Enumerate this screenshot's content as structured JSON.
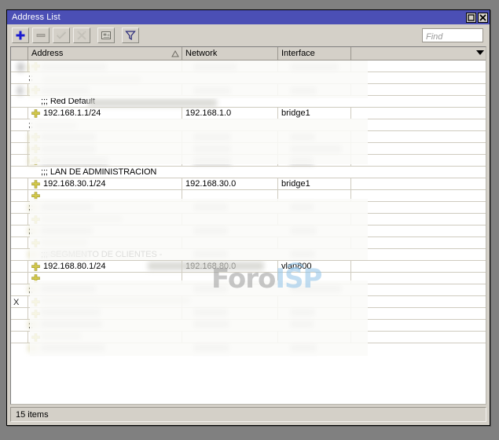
{
  "window": {
    "title": "Address List",
    "buttons": [
      {
        "name": "maximize",
        "glyph": "maximize-icon"
      },
      {
        "name": "close",
        "glyph": "close-icon"
      }
    ]
  },
  "toolbar": {
    "buttons": [
      {
        "name": "add-button",
        "icon": "plus-icon",
        "enabled": true,
        "label": "Add"
      },
      {
        "name": "remove-button",
        "icon": "minus-icon",
        "enabled": false,
        "label": "Remove"
      },
      {
        "name": "enable-button",
        "icon": "check-icon",
        "enabled": false,
        "label": "Enable"
      },
      {
        "name": "disable-button",
        "icon": "cross-icon",
        "enabled": false,
        "label": "Disable"
      },
      {
        "name": "comment-button",
        "icon": "comment-icon",
        "enabled": true,
        "label": "Comment"
      },
      {
        "name": "filter-button",
        "icon": "funnel-icon",
        "enabled": true,
        "label": "Filter"
      }
    ],
    "find_placeholder": "Find",
    "find_value": ""
  },
  "table": {
    "columns": [
      {
        "key": "flag",
        "label": ""
      },
      {
        "key": "address",
        "label": "Address",
        "sorted": "asc"
      },
      {
        "key": "network",
        "label": "Network"
      },
      {
        "key": "interface",
        "label": "Interface"
      },
      {
        "key": "extra",
        "label": ""
      }
    ],
    "rows": [
      {
        "type": "address",
        "flag": "",
        "address": "",
        "network": "",
        "interface": "",
        "redacted": true
      },
      {
        "type": "comment",
        "comment": "",
        "redacted": true
      },
      {
        "type": "address",
        "flag": "",
        "address": "",
        "network": "",
        "interface": "",
        "redacted": true
      },
      {
        "type": "comment",
        "comment": ";;; Red Default",
        "redacted_tail": true
      },
      {
        "type": "address",
        "flag": "",
        "address": "192.168.1.1/24",
        "network": "192.168.1.0",
        "interface": "bridge1"
      },
      {
        "type": "comment",
        "comment": "",
        "redacted": true
      },
      {
        "type": "address",
        "flag": "",
        "address": "",
        "network": "",
        "interface": "",
        "redacted": true
      },
      {
        "type": "address",
        "flag": "",
        "address": "",
        "network": "",
        "interface": "",
        "redacted": true
      },
      {
        "type": "address",
        "flag": "",
        "address": "",
        "network": "",
        "interface": "",
        "redacted": true
      },
      {
        "type": "comment",
        "comment": ";;; LAN DE ADMINISTRACION"
      },
      {
        "type": "address",
        "flag": "",
        "address": "192.168.30.1/24",
        "network": "192.168.30.0",
        "interface": "bridge1"
      },
      {
        "type": "address",
        "flag": "",
        "address": "",
        "network": "",
        "interface": "",
        "redacted": true
      },
      {
        "type": "comment",
        "comment": "",
        "redacted": true
      },
      {
        "type": "address",
        "flag": "",
        "address": "",
        "network": "",
        "interface": "",
        "redacted": true
      },
      {
        "type": "comment",
        "comment": "",
        "redacted": true
      },
      {
        "type": "address",
        "flag": "",
        "address": "",
        "network": "",
        "interface": "",
        "redacted": true
      },
      {
        "type": "comment",
        "comment": ";;; SEGMENTO DE CLIENTES -",
        "redacted_tail": true
      },
      {
        "type": "address",
        "flag": "",
        "address": "192.168.80.1/24",
        "network": "192.168.80.0",
        "interface": "vlan800"
      },
      {
        "type": "address",
        "flag": "",
        "address": "",
        "network": "",
        "interface": "",
        "redacted": true
      },
      {
        "type": "comment",
        "comment": "",
        "redacted": true
      },
      {
        "type": "address",
        "flag": "X",
        "address": "",
        "network": "",
        "interface": "",
        "redacted": true
      },
      {
        "type": "address",
        "flag": "",
        "address": "",
        "network": "",
        "interface": "",
        "redacted": true
      },
      {
        "type": "comment",
        "comment": "",
        "redacted": true
      },
      {
        "type": "address",
        "flag": "",
        "address": "",
        "network": "",
        "interface": "",
        "redacted": true
      }
    ]
  },
  "watermark": {
    "part1": "Foro",
    "part2": "ISP"
  },
  "statusbar": {
    "text": "15 items"
  },
  "colors": {
    "titlebar": "#4b4fb5",
    "chrome": "#d4d0c8",
    "accent_blue": "#1a1ad0",
    "address_icon": "#d2c84a",
    "watermark_gray": "#9a9a9a",
    "watermark_blue": "#8fc2e8"
  }
}
